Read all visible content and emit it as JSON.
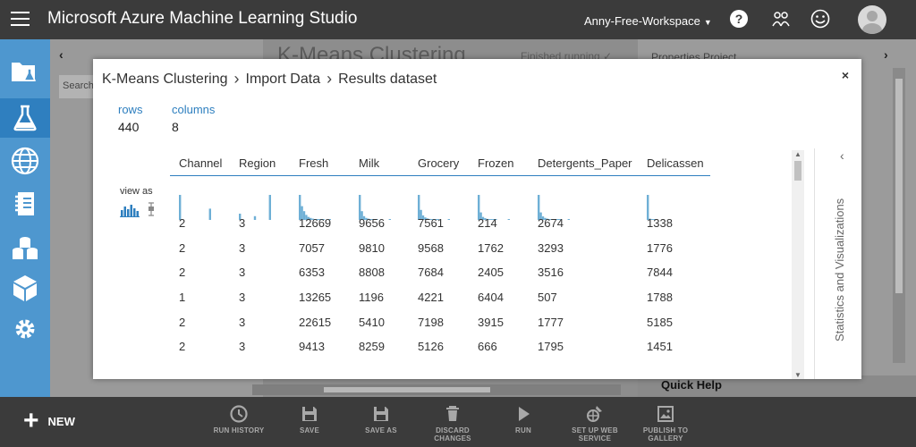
{
  "topbar": {
    "app_title": "Microsoft Azure Machine Learning Studio",
    "workspace": "Anny-Free-Workspace"
  },
  "background": {
    "canvas_title": "K-Means Clustering",
    "finished_text": "Finished running ✓",
    "properties_tabs": "Properties   Project",
    "search_placeholder": "Search",
    "quick_help": "Quick Help"
  },
  "modal": {
    "breadcrumb": [
      "K-Means Clustering",
      "Import Data",
      "Results dataset"
    ],
    "close": "×",
    "rows_label": "rows",
    "rows_value": "440",
    "columns_label": "columns",
    "columns_value": "8",
    "view_as": "view as",
    "side_panel": "Statistics and Visualizations"
  },
  "table": {
    "columns": [
      "Channel",
      "Region",
      "Fresh",
      "Milk",
      "Grocery",
      "Frozen",
      "Detergents_Paper",
      "Delicassen"
    ],
    "rows": [
      [
        "2",
        "3",
        "12669",
        "9656",
        "7561",
        "214",
        "2674",
        "1338"
      ],
      [
        "2",
        "3",
        "7057",
        "9810",
        "9568",
        "1762",
        "3293",
        "1776"
      ],
      [
        "2",
        "3",
        "6353",
        "8808",
        "7684",
        "2405",
        "3516",
        "7844"
      ],
      [
        "1",
        "3",
        "13265",
        "1196",
        "4221",
        "6404",
        "507",
        "1788"
      ],
      [
        "2",
        "3",
        "22615",
        "5410",
        "7198",
        "3915",
        "1777",
        "5185"
      ],
      [
        "2",
        "3",
        "9413",
        "8259",
        "5126",
        "666",
        "1795",
        "1451"
      ]
    ],
    "histograms": [
      [
        1.0,
        0,
        0,
        0,
        0,
        0,
        0,
        0,
        0,
        0,
        0,
        0,
        0,
        0,
        0.45
      ],
      [
        0.25,
        0,
        0,
        0,
        0,
        0,
        0,
        0.15,
        0,
        0,
        0,
        0,
        0,
        0,
        1.0
      ],
      [
        1.0,
        0.55,
        0.35,
        0.2,
        0.12,
        0.08,
        0.05,
        0.03,
        0.02,
        0.02,
        0.01,
        0.01,
        0,
        0,
        0.01
      ],
      [
        1.0,
        0.35,
        0.15,
        0.08,
        0.05,
        0.03,
        0.02,
        0.01,
        0.01,
        0,
        0,
        0,
        0,
        0,
        0.01
      ],
      [
        1.0,
        0.4,
        0.18,
        0.1,
        0.06,
        0.04,
        0.02,
        0.02,
        0.01,
        0.01,
        0,
        0,
        0,
        0,
        0.01
      ],
      [
        1.0,
        0.3,
        0.12,
        0.07,
        0.04,
        0.03,
        0.02,
        0.01,
        0.01,
        0,
        0,
        0,
        0,
        0,
        0.01
      ],
      [
        1.0,
        0.3,
        0.14,
        0.08,
        0.05,
        0.03,
        0.02,
        0.02,
        0.01,
        0.01,
        0.01,
        0,
        0,
        0,
        0.01
      ],
      [
        1.0,
        0.05,
        0.02,
        0.01,
        0,
        0,
        0,
        0,
        0,
        0,
        0,
        0,
        0,
        0,
        0
      ]
    ]
  },
  "toolbar": {
    "new": "NEW",
    "buttons": [
      {
        "label": "RUN HISTORY",
        "icon": "clock-icon"
      },
      {
        "label": "SAVE",
        "icon": "save-icon"
      },
      {
        "label": "SAVE AS",
        "icon": "save-as-icon"
      },
      {
        "label": "DISCARD CHANGES",
        "icon": "trash-icon"
      },
      {
        "label": "RUN",
        "icon": "play-icon"
      },
      {
        "label": "SET UP WEB SERVICE",
        "icon": "web-service-icon"
      },
      {
        "label": "PUBLISH TO GALLERY",
        "icon": "gallery-icon"
      }
    ]
  },
  "colors": {
    "accent": "#2e7fbf",
    "nav_bg": "#4e97cf",
    "nav_active": "#2f7fbf",
    "histogram": "#6fb0d6"
  }
}
